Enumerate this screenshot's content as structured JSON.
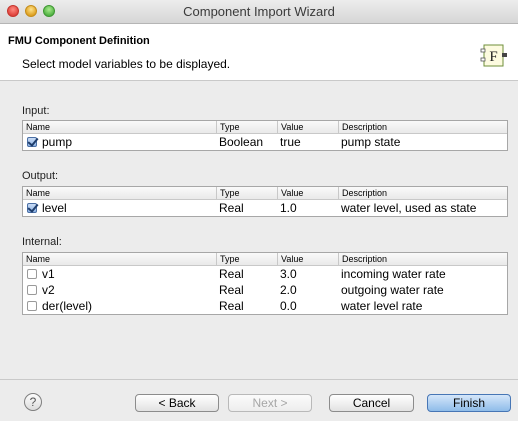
{
  "window": {
    "title": "Component Import Wizard"
  },
  "header": {
    "title": "FMU Component Definition",
    "subtitle": "Select model variables to be displayed.",
    "icon_letter": "F"
  },
  "columns": {
    "name": "Name",
    "type": "Type",
    "value": "Value",
    "description": "Description"
  },
  "sections": {
    "input": {
      "label": "Input:",
      "rows": [
        {
          "name": "pump",
          "type": "Boolean",
          "value": "true",
          "description": "pump state",
          "checked": true
        }
      ]
    },
    "output": {
      "label": "Output:",
      "rows": [
        {
          "name": "level",
          "type": "Real",
          "value": "1.0",
          "description": "water level, used as state",
          "checked": true
        }
      ]
    },
    "internal": {
      "label": "Internal:",
      "rows": [
        {
          "name": "v1",
          "type": "Real",
          "value": "3.0",
          "description": "incoming water rate",
          "checked": false
        },
        {
          "name": "v2",
          "type": "Real",
          "value": "2.0",
          "description": "outgoing water rate",
          "checked": false
        },
        {
          "name": "der(level)",
          "type": "Real",
          "value": "0.0",
          "description": "water level rate",
          "checked": false
        }
      ]
    }
  },
  "footer": {
    "help_symbol": "?",
    "back_label": "< Back",
    "next_label": "Next >",
    "cancel_label": "Cancel",
    "finish_label": "Finish"
  }
}
